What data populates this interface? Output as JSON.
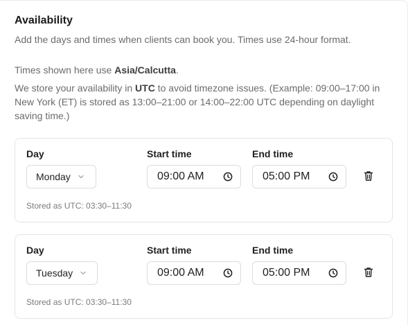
{
  "section": {
    "title": "Availability",
    "subtitle": "Add the days and times when clients can book you. Times use 24-hour format.",
    "timezone_prefix": "Times shown here use ",
    "timezone": "Asia/Calcutta",
    "timezone_suffix": ".",
    "utc_note_prefix": "We store your availability in ",
    "utc_word": "UTC",
    "utc_note_suffix": " to avoid timezone issues. (Example: 09:00–17:00 in New York (ET) is stored as 13:00–21:00 or 14:00–22:00 UTC depending on daylight saving time.)"
  },
  "labels": {
    "day": "Day",
    "start_time": "Start time",
    "end_time": "End time"
  },
  "slots": [
    {
      "day": "Monday",
      "start": "09:00 AM",
      "end": "05:00 PM",
      "stored": "Stored as UTC: 03:30–11:30"
    },
    {
      "day": "Tuesday",
      "start": "09:00 AM",
      "end": "05:00 PM",
      "stored": "Stored as UTC: 03:30–11:30"
    }
  ],
  "icons": {
    "select": "chevron-down-icon",
    "time": "clock-icon",
    "remove": "trash-icon"
  }
}
